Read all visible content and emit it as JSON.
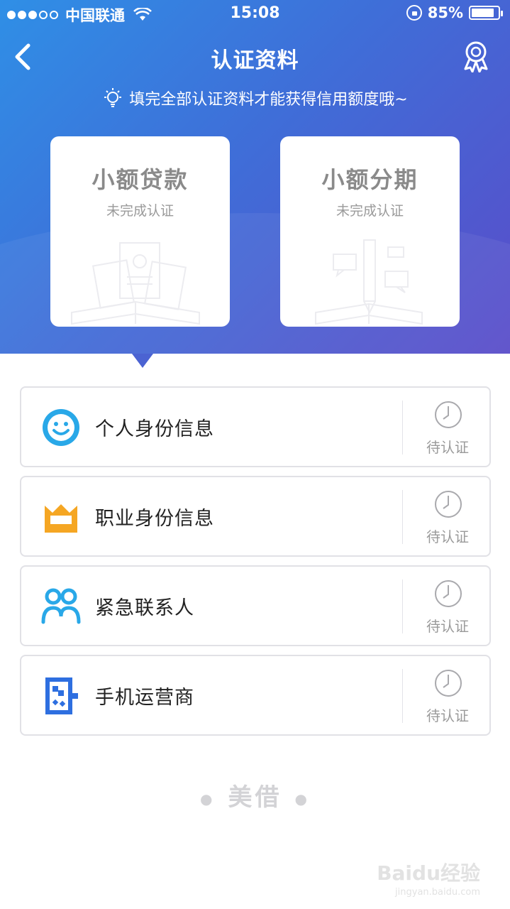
{
  "status_bar": {
    "carrier": "中国联通",
    "time": "15:08",
    "battery_percent": "85%",
    "battery_level": 0.85,
    "signal_bars_filled": 3,
    "signal_bars_total": 5
  },
  "nav": {
    "title": "认证资料",
    "back_icon": "chevron-left-icon",
    "right_icon": "award-badge-icon"
  },
  "tip": {
    "text": "填完全部认证资料才能获得信用额度哦~",
    "icon": "lightbulb-icon"
  },
  "cards": [
    {
      "title": "小额贷款",
      "status": "未完成认证",
      "illustration": "documents-book-illustration"
    },
    {
      "title": "小额分期",
      "status": "未完成认证",
      "illustration": "pencil-chat-book-illustration"
    }
  ],
  "items": [
    {
      "label": "个人身份信息",
      "status": "待认证",
      "icon": "smiley-face-icon"
    },
    {
      "label": "职业身份信息",
      "status": "待认证",
      "icon": "crown-icon"
    },
    {
      "label": "紧急联系人",
      "status": "待认证",
      "icon": "contacts-icon"
    },
    {
      "label": "手机运营商",
      "status": "待认证",
      "icon": "sim-card-icon"
    }
  ],
  "footer": {
    "brand": "美借"
  },
  "watermark": {
    "text": "Baidu经验",
    "sub": "jingyan.baidu.com"
  },
  "colors": {
    "header_start": "#2f8fe6",
    "header_end": "#5a4cc9",
    "accent_blue": "#29a8e8",
    "accent_yellow": "#f5a623",
    "status_gray": "#9a9a9a"
  }
}
